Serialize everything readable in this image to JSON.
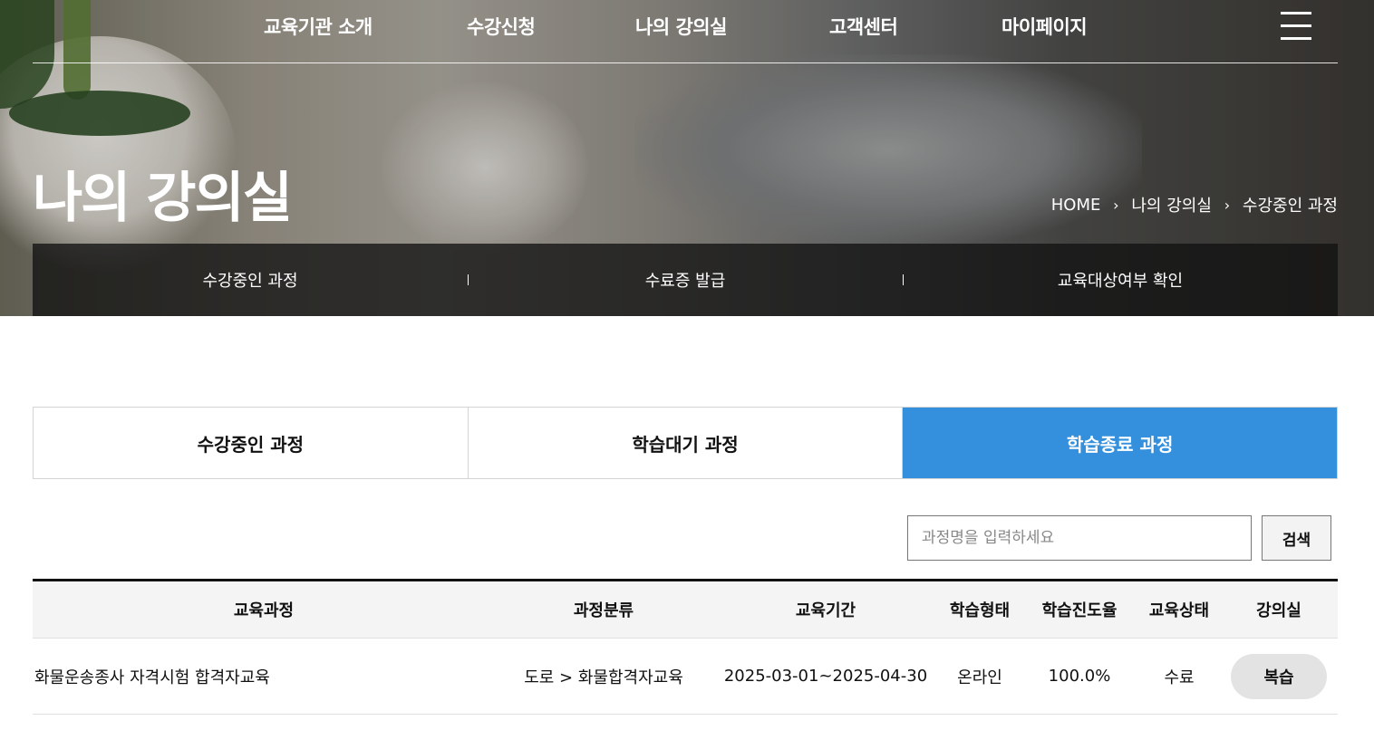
{
  "gnb": {
    "items": [
      "교육기관 소개",
      "수강신청",
      "나의 강의실",
      "고객센터",
      "마이페이지"
    ]
  },
  "page_title": "나의 강의실",
  "breadcrumb": [
    "HOME",
    "나의 강의실",
    "수강중인 과정"
  ],
  "subnav": [
    "수강중인 과정",
    "수료증 발급",
    "교육대상여부 확인"
  ],
  "tabs": [
    {
      "label": "수강중인 과정",
      "active": false
    },
    {
      "label": "학습대기 과정",
      "active": false
    },
    {
      "label": "학습종료 과정",
      "active": true
    }
  ],
  "search": {
    "placeholder": "과정명을 입력하세요",
    "value": "",
    "button_label": "검색"
  },
  "table": {
    "headers": [
      "교육과정",
      "과정분류",
      "교육기간",
      "학습형태",
      "학습진도율",
      "교육상태",
      "강의실"
    ],
    "rows": [
      {
        "course": "화물운송종사 자격시험 합격자교육",
        "category": "도로 > 화물합격자교육",
        "period": "2025-03-01~2025-04-30",
        "type": "온라인",
        "progress": "100.0%",
        "status": "수료",
        "action": "복습"
      }
    ]
  },
  "colors": {
    "accent": "#3490dc",
    "header_text": "#ffffff"
  }
}
